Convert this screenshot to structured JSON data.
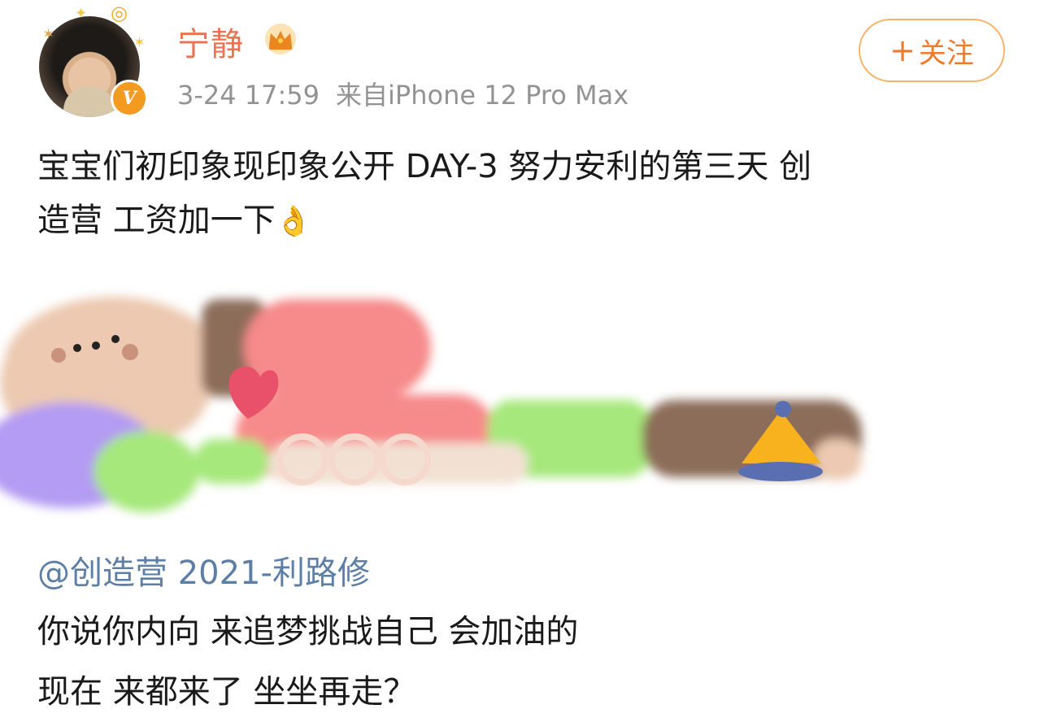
{
  "user": {
    "name": "宁静",
    "timestamp": "3-24 17:59",
    "source": "来自iPhone 12 Pro Max",
    "verified_badge": "V",
    "crown_icon": "crown-icon"
  },
  "follow_button": {
    "plus": "+",
    "label": "关注"
  },
  "post": {
    "text_line_1": "宝宝们初印象现印象公开 DAY-3 努力安利的第三天 创",
    "text_line_2": "造营 工资加一下",
    "emoji": "👌"
  },
  "repost": {
    "user": "@创造营 2021-利路修",
    "line_1": "你说你内向 来追梦挑战自己 会加油的",
    "line_2": "现在 来都来了 坐坐再走？"
  },
  "colors": {
    "username": "#eb7350",
    "link": "#5d7fa6",
    "follow": "#ee7a2a",
    "meta": "#939393"
  }
}
